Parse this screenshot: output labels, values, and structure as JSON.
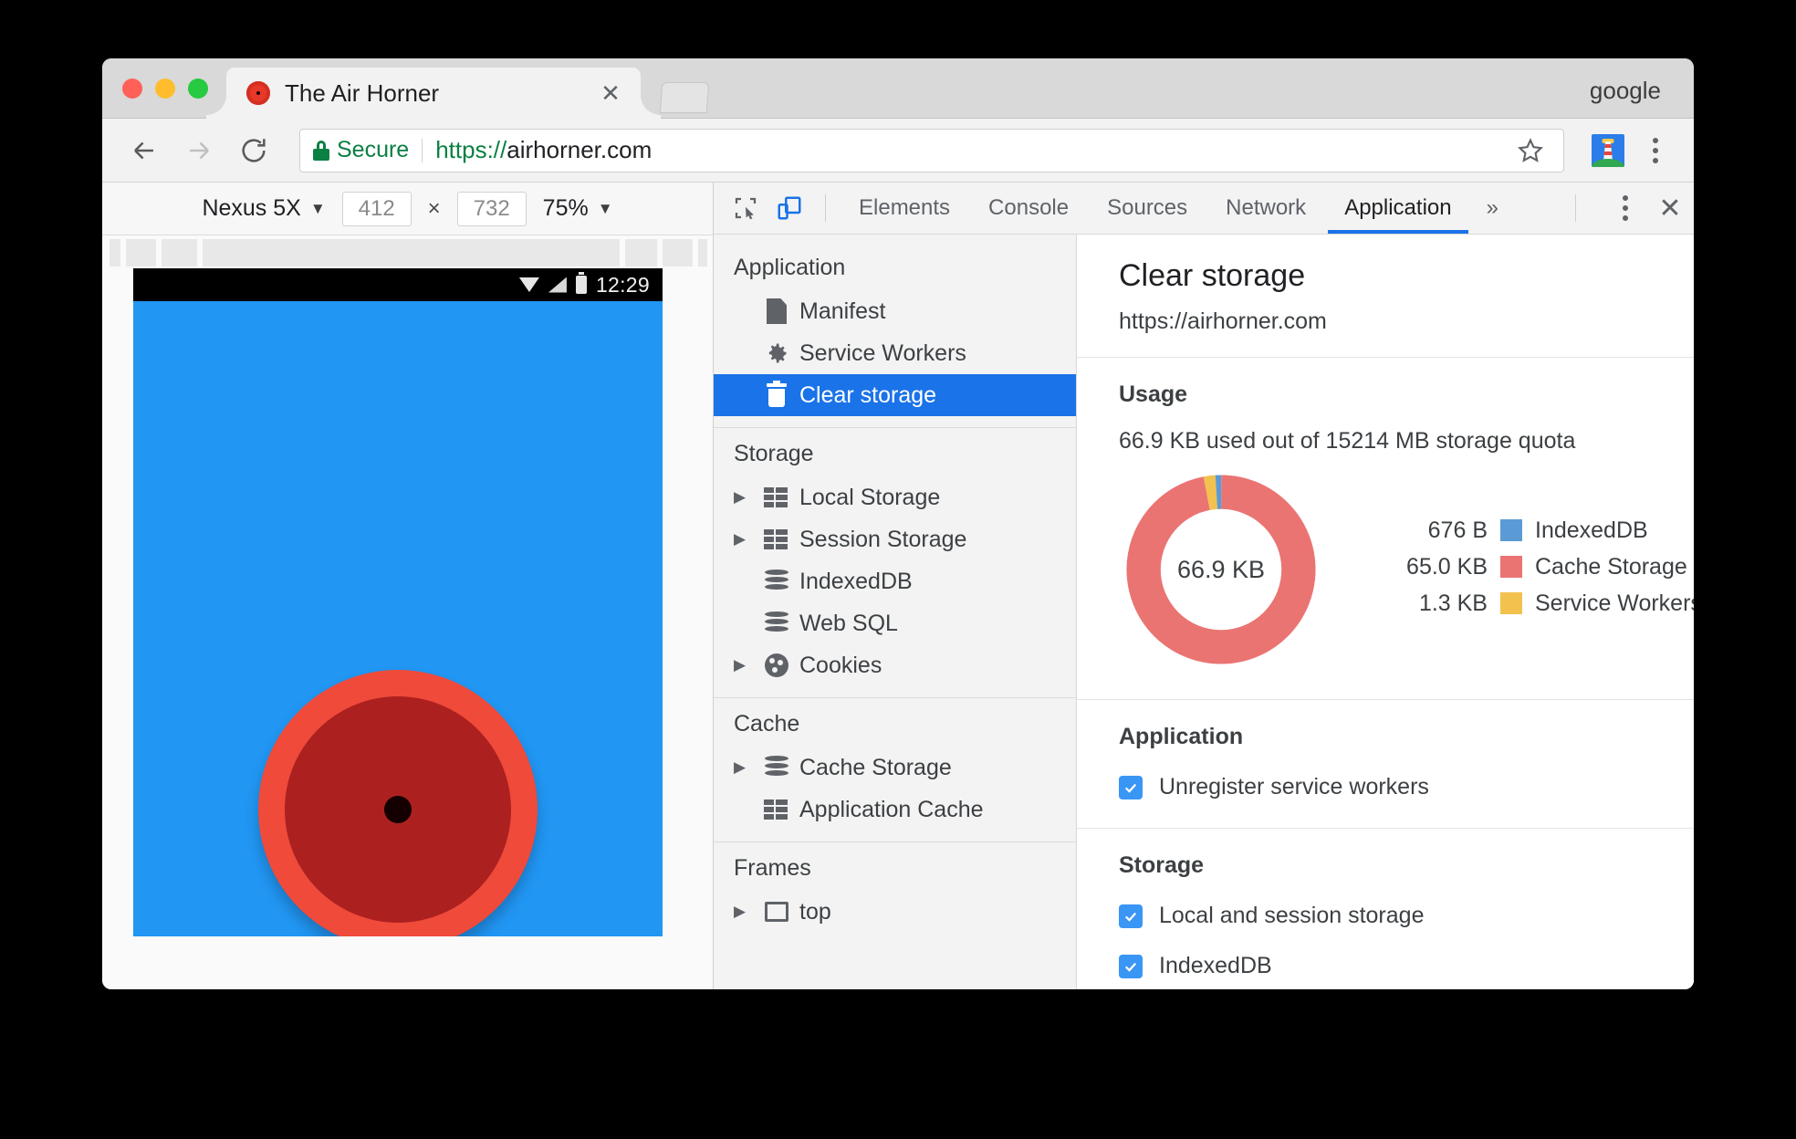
{
  "browser": {
    "profile_name": "google",
    "tab": {
      "title": "The Air Horner",
      "close_label": "✕",
      "favicon": "air-horn-favicon"
    },
    "new_tab_label": "+",
    "nav": {
      "back": "←",
      "forward": "→",
      "reload": "⟳"
    },
    "omnibox": {
      "security_label": "Secure",
      "url_scheme": "https://",
      "url_host": "airhorner.com",
      "url_full": "https://airhorner.com",
      "bookmark_icon": "star-icon",
      "extension_icon": "lighthouse-extension-icon",
      "menu_icon": "three-dot-menu-icon"
    }
  },
  "device_emulation": {
    "device_name": "Nexus 5X",
    "width": "412",
    "height": "732",
    "dimension_separator": "×",
    "zoom": "75%",
    "caret": "▼",
    "page": {
      "status_bar": {
        "time": "12:29",
        "icons": [
          "wifi-icon",
          "signal-icon",
          "battery-icon"
        ]
      },
      "background_color": "#2196f3",
      "horn_button": {
        "name": "air-horn-button",
        "outer_color": "#ef4a3a",
        "inner_color": "#ad2020",
        "center_color": "#140000"
      }
    }
  },
  "devtools": {
    "toolbar": {
      "inspect_icon": "inspect-element-icon",
      "device_toggle_icon": "toggle-device-toolbar-icon",
      "more_tabs": "»",
      "menu_icon": "three-dot-menu-icon",
      "close_icon": "✕"
    },
    "tabs": [
      {
        "label": "Elements",
        "active": false
      },
      {
        "label": "Console",
        "active": false
      },
      {
        "label": "Sources",
        "active": false
      },
      {
        "label": "Network",
        "active": false
      },
      {
        "label": "Application",
        "active": true
      }
    ],
    "sidebar": {
      "sections": [
        {
          "title": "Application",
          "items": [
            {
              "label": "Manifest",
              "icon": "document-icon",
              "arrow": false,
              "selected": false
            },
            {
              "label": "Service Workers",
              "icon": "gear-icon",
              "arrow": false,
              "selected": false
            },
            {
              "label": "Clear storage",
              "icon": "trash-icon",
              "arrow": false,
              "selected": true
            }
          ]
        },
        {
          "title": "Storage",
          "items": [
            {
              "label": "Local Storage",
              "icon": "table-icon",
              "arrow": true,
              "selected": false
            },
            {
              "label": "Session Storage",
              "icon": "table-icon",
              "arrow": true,
              "selected": false
            },
            {
              "label": "IndexedDB",
              "icon": "database-icon",
              "arrow": false,
              "selected": false
            },
            {
              "label": "Web SQL",
              "icon": "database-icon",
              "arrow": false,
              "selected": false
            },
            {
              "label": "Cookies",
              "icon": "cookie-icon",
              "arrow": true,
              "selected": false
            }
          ]
        },
        {
          "title": "Cache",
          "items": [
            {
              "label": "Cache Storage",
              "icon": "database-icon",
              "arrow": true,
              "selected": false
            },
            {
              "label": "Application Cache",
              "icon": "table-icon",
              "arrow": false,
              "selected": false
            }
          ]
        },
        {
          "title": "Frames",
          "items": [
            {
              "label": "top",
              "icon": "frame-icon",
              "arrow": true,
              "selected": false
            }
          ]
        }
      ],
      "arrow_glyph": "▶",
      "selected_color": "#1a73e8"
    },
    "clear_storage": {
      "title": "Clear storage",
      "origin": "https://airhorner.com",
      "usage": {
        "heading": "Usage",
        "summary": "66.9 KB used out of 15214 MB storage quota"
      },
      "application": {
        "heading": "Application",
        "options": [
          {
            "label": "Unregister service workers",
            "checked": true
          }
        ]
      },
      "storage": {
        "heading": "Storage",
        "options": [
          {
            "label": "Local and session storage",
            "checked": true
          },
          {
            "label": "IndexedDB",
            "checked": true
          }
        ]
      }
    }
  },
  "chart_data": {
    "type": "pie",
    "title": "Usage",
    "center_label": "66.9 KB",
    "total_label": "66.9 KB",
    "legend_position": "right",
    "categories": [
      "IndexedDB",
      "Cache Storage",
      "Service Workers"
    ],
    "values": [
      676,
      66560,
      1331
    ],
    "value_labels": [
      "676 B",
      "65.0 KB",
      "1.3 KB"
    ],
    "colors": [
      "#5b9bd5",
      "#ea7472",
      "#f2c14e"
    ],
    "units": "bytes",
    "slices": [
      {
        "name": "IndexedDB",
        "label": "676 B",
        "bytes": 676,
        "percent": 1.0,
        "color": "#5b9bd5"
      },
      {
        "name": "Cache Storage",
        "label": "65.0 KB",
        "bytes": 66560,
        "percent": 97.0,
        "color": "#ea7472"
      },
      {
        "name": "Service Workers",
        "label": "1.3 KB",
        "bytes": 1331,
        "percent": 2.0,
        "color": "#f2c14e"
      }
    ]
  }
}
